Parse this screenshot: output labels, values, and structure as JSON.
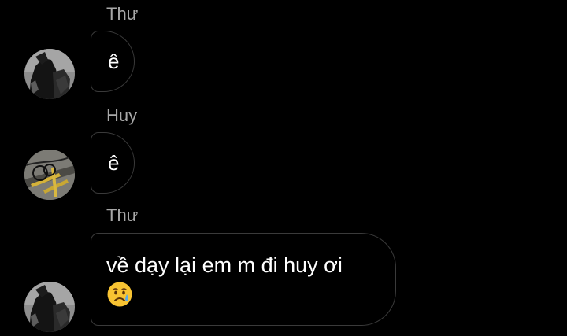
{
  "messages": [
    {
      "sender": "Thư",
      "avatar": "thu-avatar",
      "text": "ê"
    },
    {
      "sender": "Huy",
      "avatar": "huy-avatar",
      "text": "ê"
    },
    {
      "sender": "Thư",
      "avatar": "thu-avatar",
      "text": "về dạy lại em m đi huy ơi",
      "emoji": "sad-but-relieved-face-emoji"
    }
  ],
  "colors": {
    "background": "#000000",
    "bubble_border": "#3a3a3a",
    "sender_name": "#a8a8a8",
    "text": "#ffffff"
  }
}
